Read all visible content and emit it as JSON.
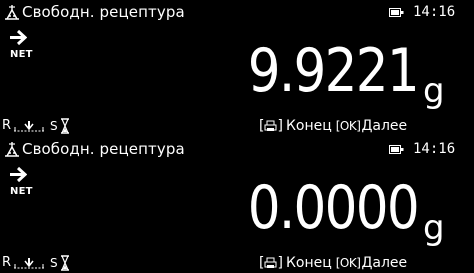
{
  "screens": [
    {
      "title": "Свободн. рецептура",
      "time": "14:16",
      "net_label": "NET",
      "weight": "9.9221",
      "unit": "g",
      "status_r": "R",
      "status_s": "S",
      "softkeys": {
        "print_open": "[",
        "print_close": "]",
        "end_label": "Конец",
        "ok_key": "[OK]",
        "next_label": "Далее"
      }
    },
    {
      "title": "Свободн. рецептура",
      "time": "14:16",
      "net_label": "NET",
      "weight": "0.0000",
      "unit": "g",
      "status_r": "R",
      "status_s": "S",
      "softkeys": {
        "print_open": "[",
        "print_close": "]",
        "end_label": "Конец",
        "ok_key": "[OK]",
        "next_label": "Далее"
      }
    }
  ],
  "icons": {
    "title": "scale-recipe-icon",
    "battery": "battery-icon",
    "net_arrow": "arrow-right-icon",
    "level": "level-bubble-icon",
    "stability": "hourglass-icon",
    "print": "print-icon"
  },
  "colors": {
    "background": "#000000",
    "foreground": "#ffffff"
  }
}
